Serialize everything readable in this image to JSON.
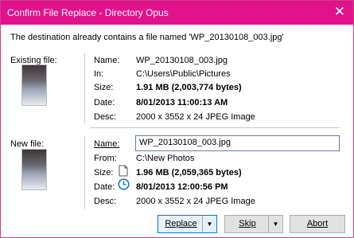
{
  "window": {
    "title": "Confirm File Replace - Directory Opus",
    "close_glyph": "✕"
  },
  "message": "The destination already contains a file named 'WP_20130108_003.jpg'",
  "existing": {
    "section_label": "Existing file:",
    "name_label": "Name:",
    "name": "WP_20130108_003.jpg",
    "in_label": "In:",
    "in": "C:\\Users\\Public\\Pictures",
    "size_label": "Size:",
    "size": "1.91 MB (2,003,774 bytes)",
    "date_label": "Date:",
    "date": "8/01/2013 11:00:13 AM",
    "desc_label": "Desc:",
    "desc": "2000 x 3552 x 24 JPEG Image"
  },
  "new_file": {
    "section_label": "New file:",
    "name_label": "Name:",
    "name": "WP_20130108_003.jpg",
    "from_label": "From:",
    "from": "C:\\New Photos",
    "size_label": "Size:",
    "size": "1.96 MB (2,059,365 bytes)",
    "date_label": "Date:",
    "date": "8/01/2013 12:00:56 PM",
    "desc_label": "Desc:",
    "desc": "2000 x 3552 x 24 JPEG Image"
  },
  "buttons": {
    "replace": "Replace",
    "skip": "Skip",
    "abort": "Abort",
    "dropdown_glyph": "▼"
  },
  "colors": {
    "titlebar": "#e0138c",
    "accent": "#0078d7",
    "clock_icon": "#1a73c9"
  }
}
